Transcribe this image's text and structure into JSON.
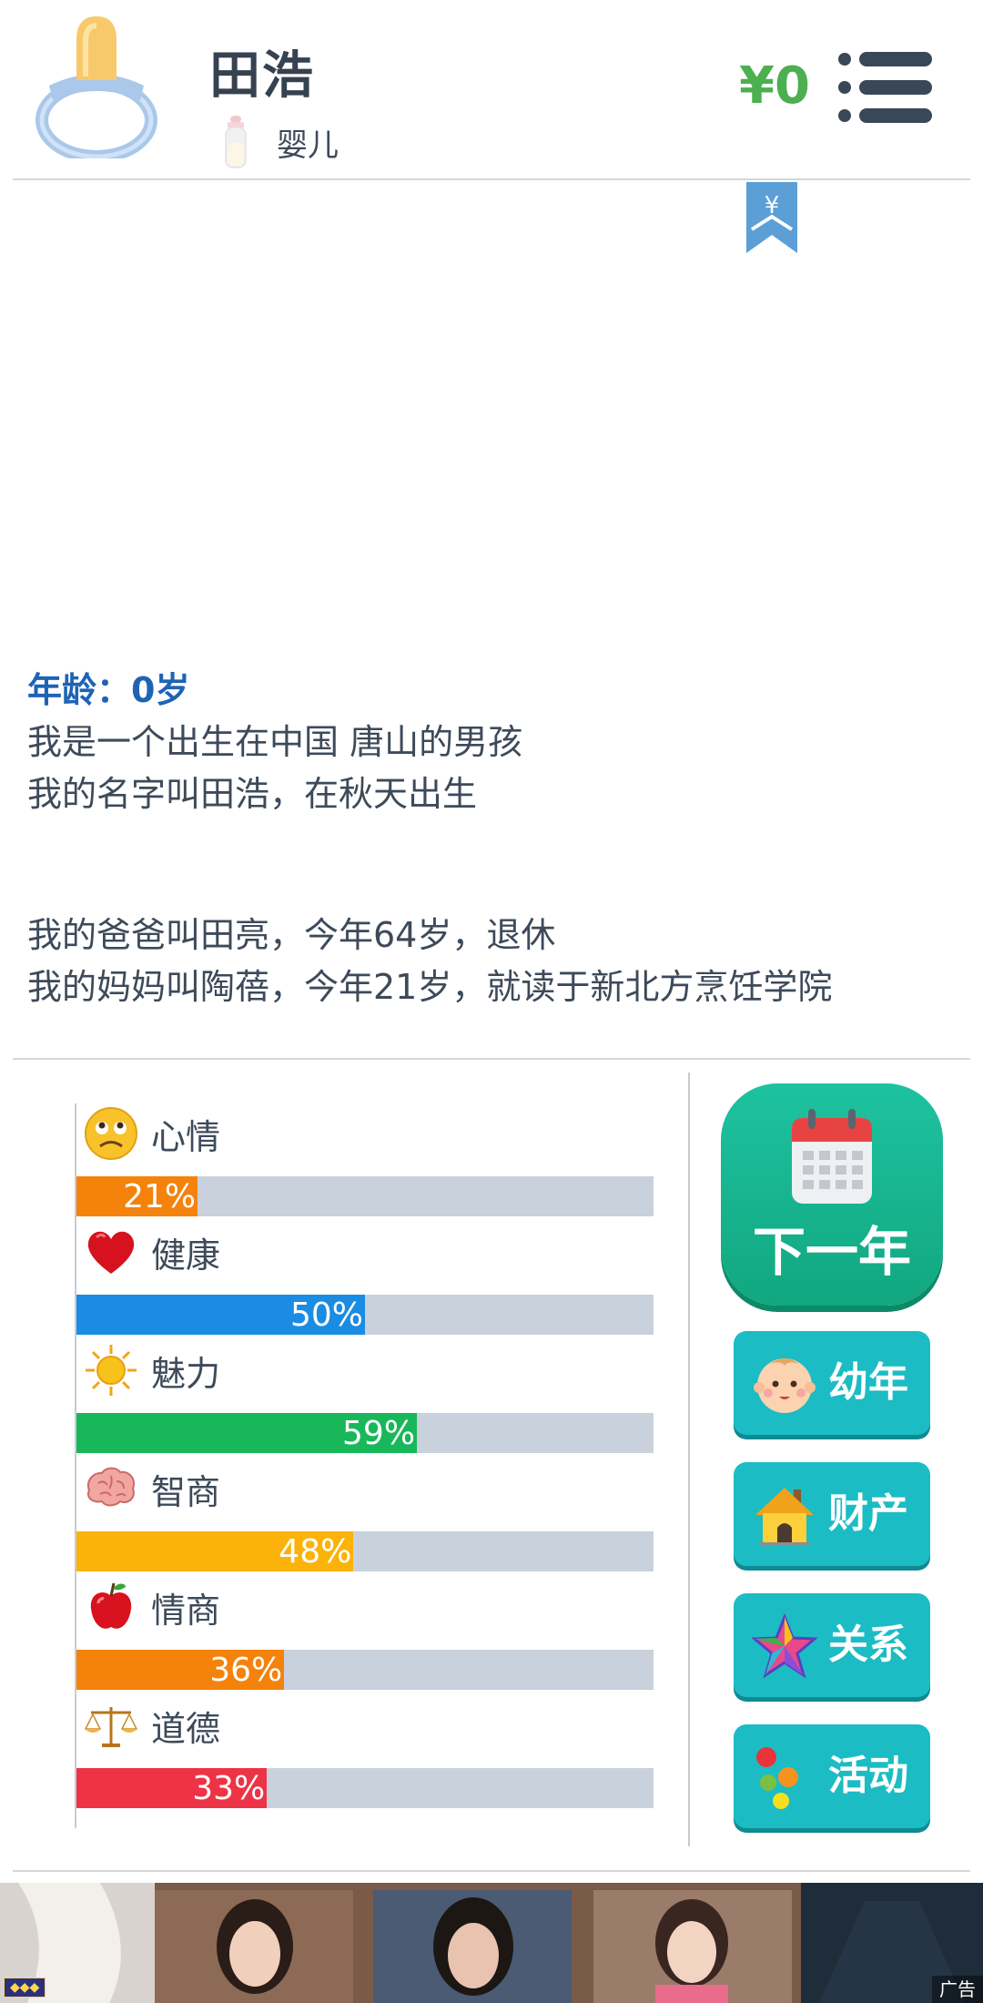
{
  "header": {
    "name": "田浩",
    "stage": "婴儿",
    "money": "¥0"
  },
  "ribbon": {
    "symbol": "¥"
  },
  "story": {
    "age": "年龄：0岁",
    "lines_a": [
      "我是一个出生在中国 唐山的男孩",
      "我的名字叫田浩，在秋天出生"
    ],
    "lines_b": [
      "我的爸爸叫田亮，今年64岁，退休",
      "我的妈妈叫陶蓓，今年21岁，就读于新北方烹饪学院"
    ]
  },
  "stats": [
    {
      "label": "心情",
      "value": 0.21,
      "text": "21%",
      "color": "#f5820b",
      "icon": "sad-face-icon"
    },
    {
      "label": "健康",
      "value": 0.5,
      "text": "50%",
      "color": "#1a8ce3",
      "icon": "heart-icon"
    },
    {
      "label": "魅力",
      "value": 0.59,
      "text": "59%",
      "color": "#18b85a",
      "icon": "sun-icon"
    },
    {
      "label": "智商",
      "value": 0.48,
      "text": "48%",
      "color": "#fbb30a",
      "icon": "brain-icon"
    },
    {
      "label": "情商",
      "value": 0.36,
      "text": "36%",
      "color": "#f5820b",
      "icon": "apple-icon"
    },
    {
      "label": "道德",
      "value": 0.33,
      "text": "33%",
      "color": "#ee3346",
      "icon": "scales-icon"
    }
  ],
  "actions": {
    "next_year": "下一年",
    "buttons": [
      {
        "label": "幼年",
        "icon": "baby-face-icon"
      },
      {
        "label": "财产",
        "icon": "house-icon"
      },
      {
        "label": "关系",
        "icon": "star-icon"
      },
      {
        "label": "活动",
        "icon": "activity-dots-icon"
      }
    ]
  },
  "ad": {
    "tag": "广告"
  },
  "colors": {
    "money": "#4caf50",
    "age": "#1e63b5",
    "next_year": "#11a77f",
    "side_button": "#1cbcc4"
  }
}
